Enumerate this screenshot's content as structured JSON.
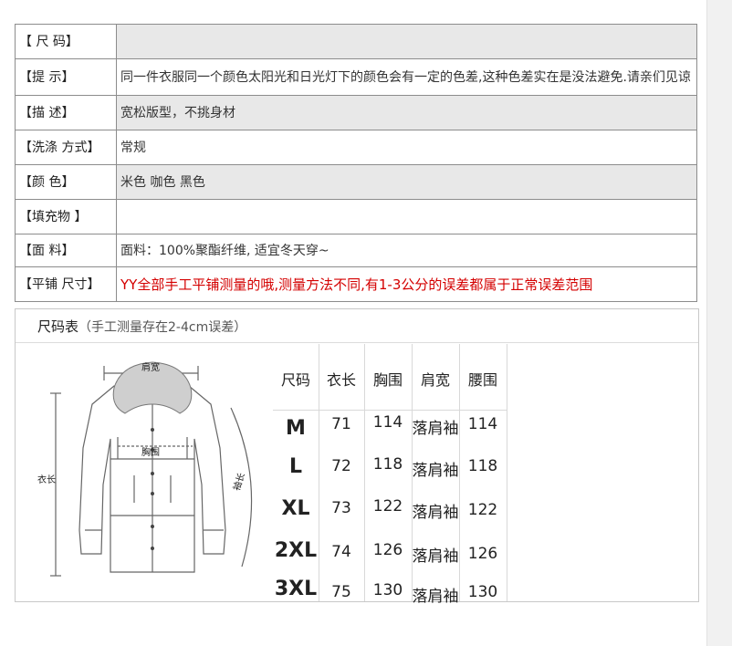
{
  "info_rows": [
    {
      "label": "【 尺 码】",
      "value": ""
    },
    {
      "label": "【提 示】",
      "value": "同一件衣服同一个颜色太阳光和日光灯下的颜色会有一定的色差,这种色差实在是没法避免.请亲们见谅"
    },
    {
      "label": "【描 述】",
      "value": "宽松版型，不挑身材"
    },
    {
      "label": "【洗涤 方式】",
      "value": "常规"
    },
    {
      "label": "【颜 色】",
      "value": "米色  咖色 黑色"
    },
    {
      "label": "【填充物 】",
      "value": ""
    },
    {
      "label": "【面 料】",
      "value": "面料：100%聚酯纤维, 适宜冬天穿~"
    },
    {
      "label": "【平铺 尺寸】",
      "value": "YY全部手工平铺测量的哦,测量方法不同,有1-3公分的误差都属于正常误差范围"
    }
  ],
  "size_chart": {
    "title": "尺码表",
    "subtitle": "（手工测量存在2-4cm误差）",
    "sketch_labels": {
      "shoulder": "肩宽",
      "chest": "胸围",
      "length": "衣长",
      "sleeve": "袖长"
    },
    "headers": [
      "尺码",
      "衣长",
      "胸围",
      "肩宽",
      "腰围"
    ],
    "rows": [
      [
        "M",
        "71",
        "114",
        "落肩袖",
        "114"
      ],
      [
        "L",
        "72",
        "118",
        "落肩袖",
        "118"
      ],
      [
        "XL",
        "73",
        "122",
        "落肩袖",
        "122"
      ],
      [
        "2XL",
        "74",
        "126",
        "落肩袖",
        "126"
      ],
      [
        "3XL",
        "75",
        "130",
        "落肩袖",
        "130"
      ]
    ]
  }
}
